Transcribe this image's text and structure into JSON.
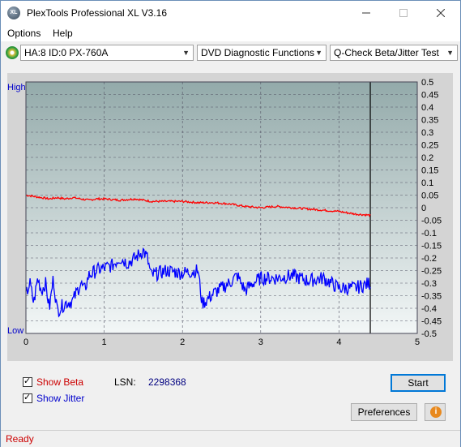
{
  "window": {
    "title": "PlexTools Professional XL V3.16",
    "icon_text": "XL",
    "controls": [
      "minimize-icon",
      "maximize-icon",
      "close-icon"
    ]
  },
  "menu": {
    "items": [
      {
        "label": "Options"
      },
      {
        "label": "Help"
      }
    ]
  },
  "toolbar": {
    "drive": "HA:8 ID:0  PX-760A",
    "function": "DVD Diagnostic Functions",
    "test": "Q-Check Beta/Jitter Test"
  },
  "chart": {
    "left_axis_high": "High",
    "left_axis_low": "Low",
    "x_ticks": [
      "0",
      "1",
      "2",
      "3",
      "4",
      "5"
    ],
    "y_ticks": [
      "0.5",
      "0.45",
      "0.4",
      "0.35",
      "0.3",
      "0.25",
      "0.2",
      "0.15",
      "0.1",
      "0.05",
      "0",
      "-0.05",
      "-0.1",
      "-0.15",
      "-0.2",
      "-0.25",
      "-0.3",
      "-0.35",
      "-0.4",
      "-0.45",
      "-0.5"
    ]
  },
  "chart_data": {
    "type": "line",
    "xlim": [
      0,
      5
    ],
    "ylim": [
      -0.5,
      0.5
    ],
    "grid": true,
    "end_marker_x": 4.4,
    "colors": {
      "beta": "#ff0000",
      "jitter": "#0000ff"
    },
    "series": [
      {
        "key": "beta",
        "x": [
          0,
          0.1,
          0.2,
          0.3,
          0.4,
          0.5,
          0.6,
          0.7,
          0.8,
          0.9,
          1.0,
          1.2,
          1.4,
          1.6,
          1.8,
          2.0,
          2.2,
          2.4,
          2.6,
          2.8,
          3.0,
          3.2,
          3.4,
          3.6,
          3.8,
          4.0,
          4.2,
          4.4
        ],
        "y": [
          0.05,
          0.045,
          0.04,
          0.035,
          0.04,
          0.035,
          0.04,
          0.035,
          0.03,
          0.035,
          0.035,
          0.03,
          0.035,
          0.025,
          0.025,
          0.025,
          0.02,
          0.02,
          0.015,
          0.005,
          0.0,
          0.005,
          0.0,
          -0.005,
          -0.01,
          -0.015,
          -0.025,
          -0.03
        ]
      },
      {
        "key": "jitter",
        "x": [
          0,
          0.05,
          0.1,
          0.15,
          0.2,
          0.25,
          0.3,
          0.35,
          0.4,
          0.5,
          0.6,
          0.7,
          0.75,
          0.8,
          0.9,
          1.0,
          1.1,
          1.2,
          1.3,
          1.4,
          1.5,
          1.55,
          1.6,
          1.8,
          2.0,
          2.2,
          2.25,
          2.3,
          2.4,
          2.6,
          2.7,
          2.8,
          2.9,
          3.0,
          3.2,
          3.4,
          3.6,
          3.8,
          4.0,
          4.2,
          4.4
        ],
        "y": [
          -0.35,
          -0.3,
          -0.38,
          -0.28,
          -0.33,
          -0.3,
          -0.4,
          -0.28,
          -0.41,
          -0.38,
          -0.37,
          -0.3,
          -0.33,
          -0.27,
          -0.25,
          -0.24,
          -0.23,
          -0.2,
          -0.22,
          -0.2,
          -0.17,
          -0.2,
          -0.27,
          -0.25,
          -0.26,
          -0.25,
          -0.38,
          -0.37,
          -0.34,
          -0.3,
          -0.27,
          -0.33,
          -0.3,
          -0.28,
          -0.28,
          -0.27,
          -0.29,
          -0.28,
          -0.32,
          -0.32,
          -0.3
        ]
      }
    ]
  },
  "controls": {
    "show_beta_label": "Show Beta",
    "show_jitter_label": "Show Jitter",
    "show_beta_checked": true,
    "show_jitter_checked": true,
    "lsn_label": "LSN:",
    "lsn_value": "2298368",
    "start_label": "Start",
    "preferences_label": "Preferences",
    "info_symbol": "i"
  },
  "status": {
    "text": "Ready"
  }
}
